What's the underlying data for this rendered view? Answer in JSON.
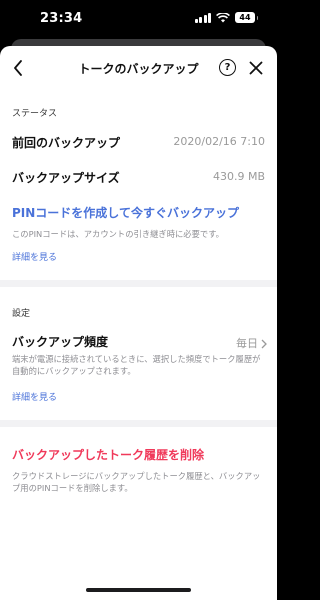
{
  "status_bar": {
    "time": "23:34",
    "battery": "44"
  },
  "header": {
    "title": "トークのバックアップ",
    "help_symbol": "?",
    "icons": [
      "back-icon",
      "help-icon",
      "close-icon"
    ]
  },
  "status_section": {
    "label": "ステータス",
    "last_backup_label": "前回のバックアップ",
    "last_backup_value": "2020/02/16 7:10",
    "backup_size_label": "バックアップサイズ",
    "backup_size_value": "430.9 MB"
  },
  "pin": {
    "link": "PINコードを作成して今すぐバックアップ",
    "description": "このPINコードは、アカウントの引き継ぎ時に必要です。",
    "detail_link": "詳細を見る"
  },
  "settings_section": {
    "label": "設定",
    "frequency_label": "バックアップ頻度",
    "frequency_value": "毎日",
    "description": "端末が電源に接続されているときに、選択した頻度でトーク履歴が自動的にバックアップされます。",
    "detail_link": "詳細を見る"
  },
  "delete_section": {
    "link": "バックアップしたトーク履歴を削除",
    "description": "クラウドストレージにバックアップしたトーク履歴と、バックアップ用のPINコードを削除します。"
  },
  "colors": {
    "accent_blue": "#4a72d9",
    "danger_red": "#f0395a",
    "secondary_text": "#8e8e93"
  }
}
